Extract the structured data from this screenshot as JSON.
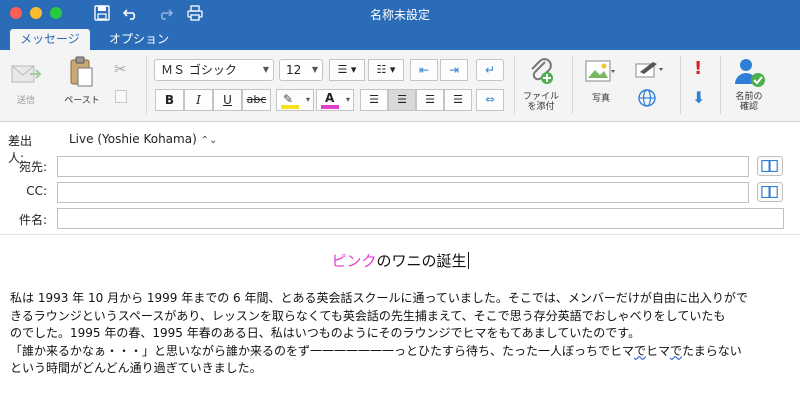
{
  "window": {
    "title": "名称未設定"
  },
  "tabs": [
    {
      "label": "メッセージ"
    },
    {
      "label": "オプション"
    }
  ],
  "ribbon": {
    "send_label": "送信",
    "paste_label": "ペースト",
    "font_name": "ＭＳ ゴシック",
    "font_size": "12",
    "attach_label_line1": "ファイル",
    "attach_label_line2": "を添付",
    "picture_label": "写真",
    "check_names_line1": "名前の",
    "check_names_line2": "確認",
    "bold": "B",
    "italic": "I",
    "underline": "U",
    "strike": "abc",
    "highlight_color": "#f7e21b",
    "font_color": "#e040d0"
  },
  "header": {
    "from_label": "差出人:",
    "from_value": "Live (Yoshie Kohama)",
    "to_label": "宛先:",
    "cc_label": "CC:",
    "subject_label": "件名:",
    "to_value": "",
    "cc_value": "",
    "subject_value": ""
  },
  "message": {
    "title_pink": "ピンク",
    "title_rest": "のワニの誕生",
    "lines": [
      "私は 1993 年 10 月から 1999 年までの 6 年間、とある英会話スクールに通っていました。そこでは、メンバーだけが自由に出入りがで",
      "きるラウンジというスペースがあり、レッスンを取らなくても英会話の先生捕まえて、そこで思う存分英語でおしゃべりをしていたも",
      "のでした。1995 年の春、1995 年春のある日、私はいつものようにそのラウンジでヒマをもてあましていたのです。"
    ],
    "line4_part1": "「誰か来るかなぁ・・・」と思いながら誰か来るのをず一一一一一一一っとひたすら待ち、たった一人ぼっちでヒマ",
    "line4_squig1": "で",
    "line4_part2": "ヒマ",
    "line4_squig2": "で",
    "line4_part3": "たまらない",
    "line5": "という時間がどんどん通り過ぎていきました。"
  },
  "colors": {
    "titlebar": "#2b6cb8",
    "ribbon_bg": "#f4f4f4",
    "accent_red": "#e02020",
    "accent_blue": "#2f7fd6"
  }
}
